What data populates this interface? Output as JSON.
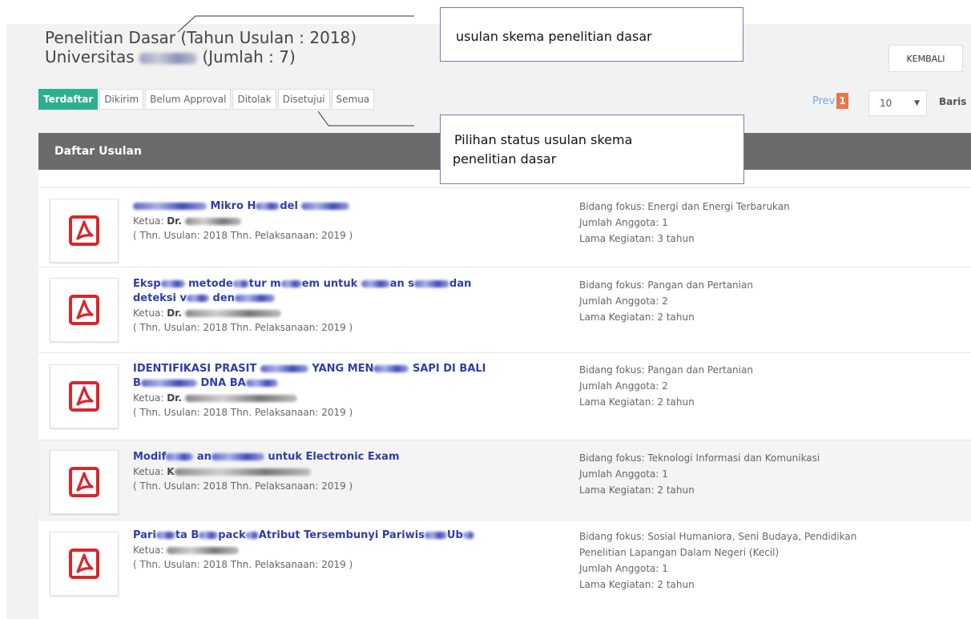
{
  "header": {
    "title_line1": "Penelitian Dasar  (Tahun Usulan : 2018)",
    "title_line2_prefix": "Universitas ",
    "title_line2_suffix": " (Jumlah : 7)",
    "back_button": "KEMBALI"
  },
  "tabs": [
    {
      "label": "Terdaftar",
      "active": true
    },
    {
      "label": "Dikirim"
    },
    {
      "label": "Belum Approval"
    },
    {
      "label": "Ditolak"
    },
    {
      "label": "Disetujui"
    },
    {
      "label": "Semua"
    }
  ],
  "pagination": {
    "prev": "Prev",
    "current": "1",
    "per_page": "10",
    "rows_label": "Baris"
  },
  "panel": {
    "title": "Daftar Usulan"
  },
  "proposals": [
    {
      "title_visible": "Mikro H",
      "title_tail": "del",
      "ketua_label": "Ketua:",
      "ketua_name": "Dr.",
      "years": "( Thn. Usulan: 2018 Thn. Pelaksanaan: 2019 )",
      "bidang": "Bidang fokus: Energi dan Energi Terbarukan",
      "anggota": "Jumlah Anggota: 1",
      "lama": "Lama Kegiatan: 3 tahun"
    },
    {
      "title_visible": "Eksp",
      "title_mid1": "metode",
      "title_mid2": "tur m",
      "title_mid3": "em untuk",
      "title_mid4": "an s",
      "title_tail": "dan",
      "title_line2a": "deteksi v",
      "title_line2b": "den",
      "ketua_label": "Ketua:",
      "ketua_name": "Dr.",
      "years": "( Thn. Usulan: 2018 Thn. Pelaksanaan: 2019 )",
      "bidang": "Bidang fokus: Pangan dan Pertanian",
      "anggota": "Jumlah Anggota: 2",
      "lama": "Lama Kegiatan: 2 tahun"
    },
    {
      "title_visible": "IDENTIFIKASI P",
      "title_mid1": "RASIT",
      "title_mid2": "YANG MEN",
      "title_tail": "SAPI DI BALI",
      "title_line2a": "B",
      "title_line2b": "DNA BA",
      "ketua_label": "Ketua:",
      "ketua_name": "Dr.",
      "years": "( Thn. Usulan: 2018 Thn. Pelaksanaan: 2019 )",
      "bidang": "Bidang fokus: Pangan dan Pertanian",
      "anggota": "Jumlah Anggota: 2",
      "lama": "Lama Kegiatan: 2 tahun"
    },
    {
      "title_visible": "Modif",
      "title_mid1": "an",
      "title_tail": "untuk Electronic Exam",
      "ketua_label": "Ketua:",
      "ketua_name": "K",
      "years": "( Thn. Usulan: 2018 Thn. Pelaksanaan: 2019 )",
      "bidang": "Bidang fokus: Teknologi Informasi dan Komunikasi",
      "anggota": "Jumlah Anggota: 1",
      "lama": "Lama Kegiatan: 2 tahun"
    },
    {
      "title_visible": "Pari",
      "title_mid1": "ta B",
      "title_mid2": "pack",
      "title_tail": "Atribut Tersembunyi Pariwis",
      "title_end": "Ub",
      "ketua_label": "Ketua:",
      "ketua_name": "",
      "years": "( Thn. Usulan: 2018 Thn. Pelaksanaan: 2019 )",
      "bidang": "Bidang fokus: Sosial Humaniora, Seni Budaya, Pendidikan",
      "bidang_line2": "Penelitian Lapangan Dalam Negeri (Kecil)",
      "anggota": "Jumlah Anggota: 1",
      "lama": "Lama Kegiatan: 2 tahun"
    }
  ],
  "annotations": {
    "callout1": "usulan skema penelitian dasar",
    "callout2_line1": "Pilihan status usulan skema",
    "callout2_line2": "penelitian dasar"
  },
  "colors": {
    "active_tab": "#2bb08f",
    "page_current": "#e8774a",
    "panel_header": "#6b6b6b",
    "title_link": "#2f3ea8",
    "pdf_icon": "#d9262b"
  }
}
